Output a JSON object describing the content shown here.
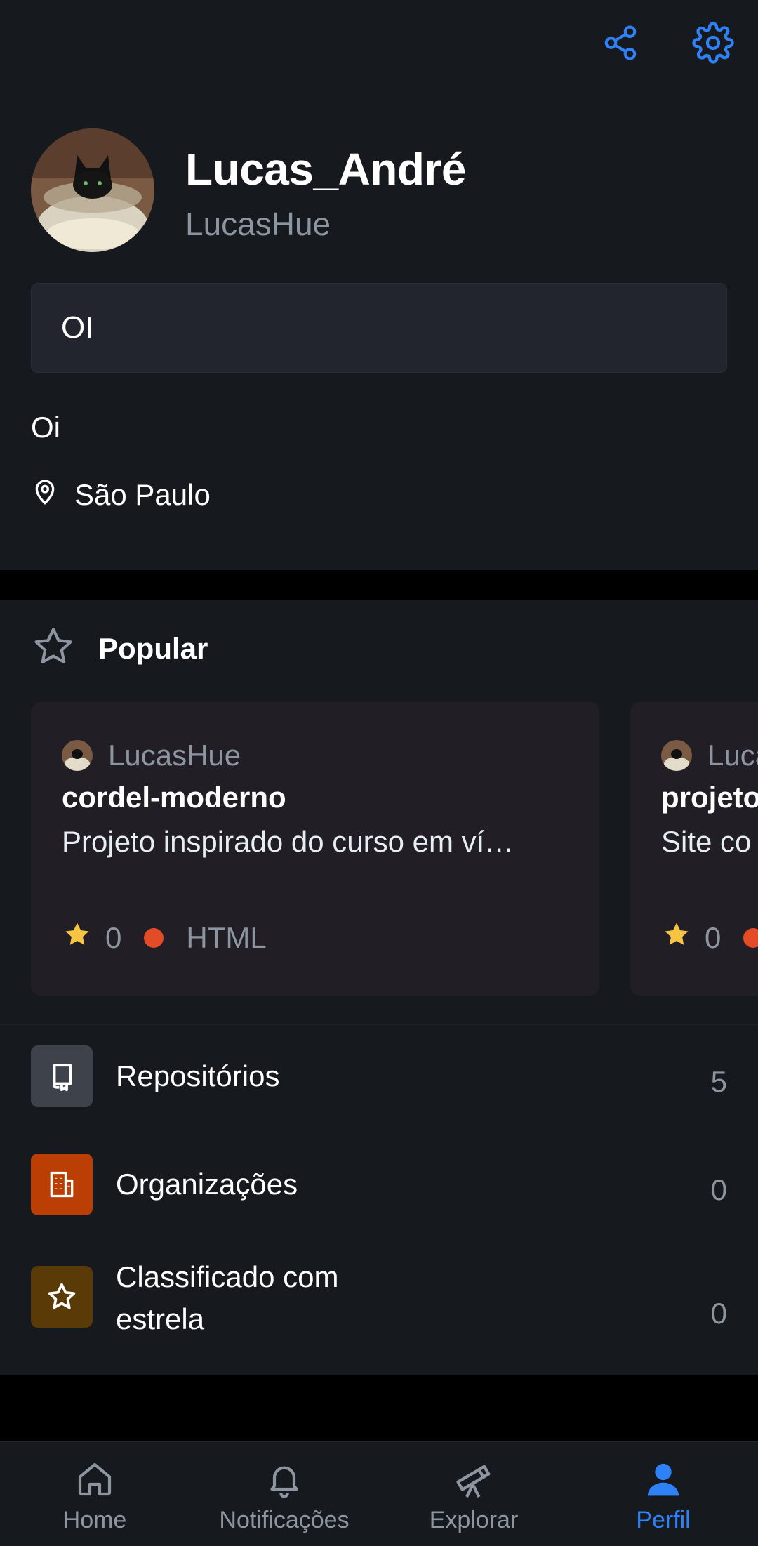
{
  "profile": {
    "display_name": "Lucas_André",
    "login": "LucasHue",
    "status": "OI",
    "bio": "Oi",
    "location": "São Paulo"
  },
  "popular": {
    "title": "Popular",
    "cards": [
      {
        "owner": "LucasHue",
        "name": "cordel-moderno",
        "description": "Projeto inspirado do curso em ví…",
        "stars": "0",
        "language": "HTML",
        "language_color": "#e34c26"
      },
      {
        "owner": "LucasHue",
        "name": "projeto",
        "description": "Site co",
        "stars": "0",
        "language": "",
        "language_color": "#e34c26"
      }
    ]
  },
  "lists": {
    "repositories": {
      "label": "Repositórios",
      "count": "5",
      "icon": "repo-icon",
      "color": "#3d424b"
    },
    "organizations": {
      "label": "Organizações",
      "count": "0",
      "icon": "organization-icon",
      "color": "#bb3f05"
    },
    "starred": {
      "label_line1": "Classificado com",
      "label_line2": "estrela",
      "count": "0",
      "icon": "star-icon",
      "color": "#5a3a06"
    }
  },
  "nav": {
    "home": "Home",
    "notifications": "Notificações",
    "explore": "Explorar",
    "profile": "Perfil",
    "active": "profile",
    "active_color": "#2f81f7"
  }
}
